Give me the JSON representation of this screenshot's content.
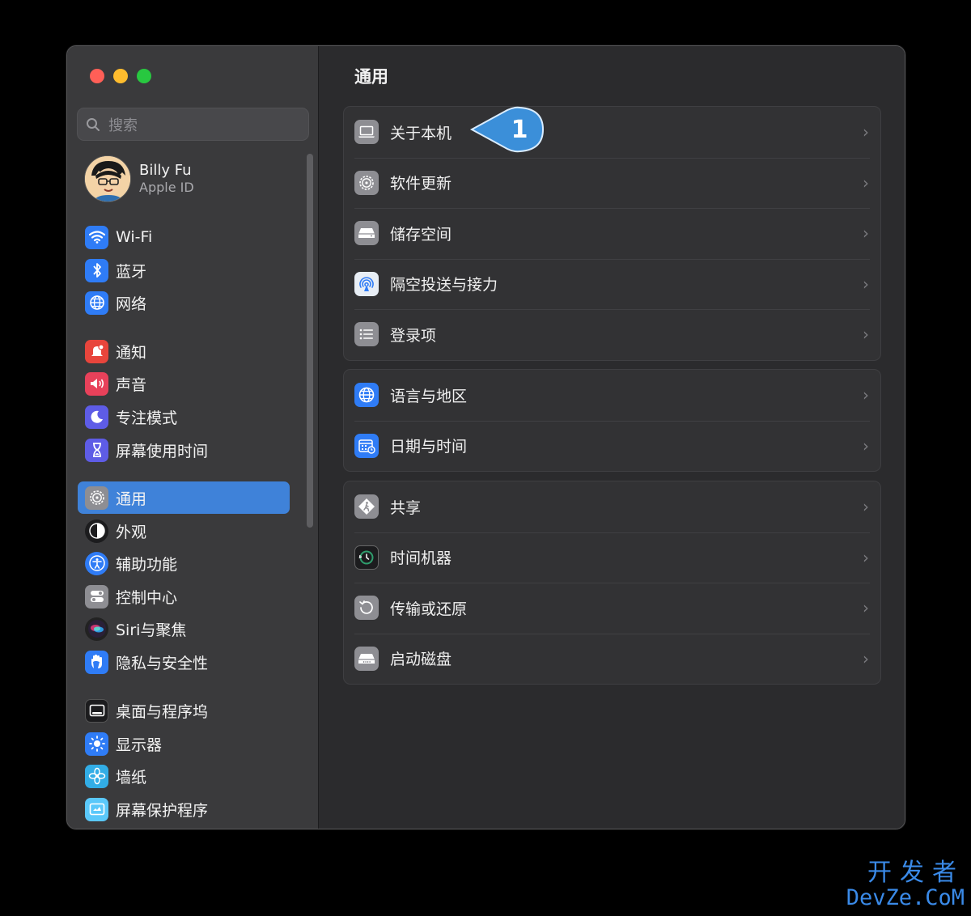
{
  "window": {
    "sidebar": {
      "search_placeholder": "搜索",
      "account": {
        "name": "Billy Fu",
        "subtitle": "Apple ID"
      },
      "items": [
        {
          "label": "Wi-Fi",
          "icon": "wifi-icon",
          "color": "#2f7cf6"
        },
        {
          "label": "蓝牙",
          "icon": "bluetooth-icon",
          "color": "#2f7cf6"
        },
        {
          "label": "网络",
          "icon": "globe-icon",
          "color": "#2f7cf6"
        },
        {
          "label": "通知",
          "icon": "bell-icon",
          "color": "#e8453c"
        },
        {
          "label": "声音",
          "icon": "speaker-icon",
          "color": "#e8415a"
        },
        {
          "label": "专注模式",
          "icon": "moon-icon",
          "color": "#5e5ce6"
        },
        {
          "label": "屏幕使用时间",
          "icon": "hourglass-icon",
          "color": "#5e5ce6"
        },
        {
          "label": "通用",
          "icon": "gear-icon",
          "color": "#8e8e93",
          "active": true
        },
        {
          "label": "外观",
          "icon": "appearance-icon",
          "color": "#1c1c1e"
        },
        {
          "label": "辅助功能",
          "icon": "accessibility-icon",
          "color": "#2f7cf6"
        },
        {
          "label": "控制中心",
          "icon": "toggles-icon",
          "color": "#8e8e93"
        },
        {
          "label": "Siri与聚焦",
          "icon": "siri-icon",
          "color": "#222"
        },
        {
          "label": "隐私与安全性",
          "icon": "hand-icon",
          "color": "#2f7cf6"
        },
        {
          "label": "桌面与程序坞",
          "icon": "dock-icon",
          "color": "#1c1c1e"
        },
        {
          "label": "显示器",
          "icon": "sun-icon",
          "color": "#2f7cf6"
        },
        {
          "label": "墙纸",
          "icon": "flower-icon",
          "color": "#32ade6"
        },
        {
          "label": "屏幕保护程序",
          "icon": "screensaver-icon",
          "color": "#5ac8fa"
        }
      ]
    },
    "content": {
      "title": "通用",
      "groups": [
        [
          {
            "label": "关于本机",
            "icon": "laptop-icon"
          },
          {
            "label": "软件更新",
            "icon": "gear-icon"
          },
          {
            "label": "储存空间",
            "icon": "drive-icon"
          },
          {
            "label": "隔空投送与接力",
            "icon": "airdrop-icon"
          },
          {
            "label": "登录项",
            "icon": "list-icon"
          }
        ],
        [
          {
            "label": "语言与地区",
            "icon": "globe-icon"
          },
          {
            "label": "日期与时间",
            "icon": "calendar-icon"
          }
        ],
        [
          {
            "label": "共享",
            "icon": "sharing-icon"
          },
          {
            "label": "时间机器",
            "icon": "timemachine-icon"
          },
          {
            "label": "传输或还原",
            "icon": "restore-icon"
          },
          {
            "label": "启动磁盘",
            "icon": "disk-icon"
          }
        ]
      ],
      "chevron": "›"
    },
    "callout": {
      "number": "1",
      "color": "#3b8fd9"
    }
  },
  "watermark": {
    "line1": "开发者",
    "line2": "DevZe.CoM"
  }
}
